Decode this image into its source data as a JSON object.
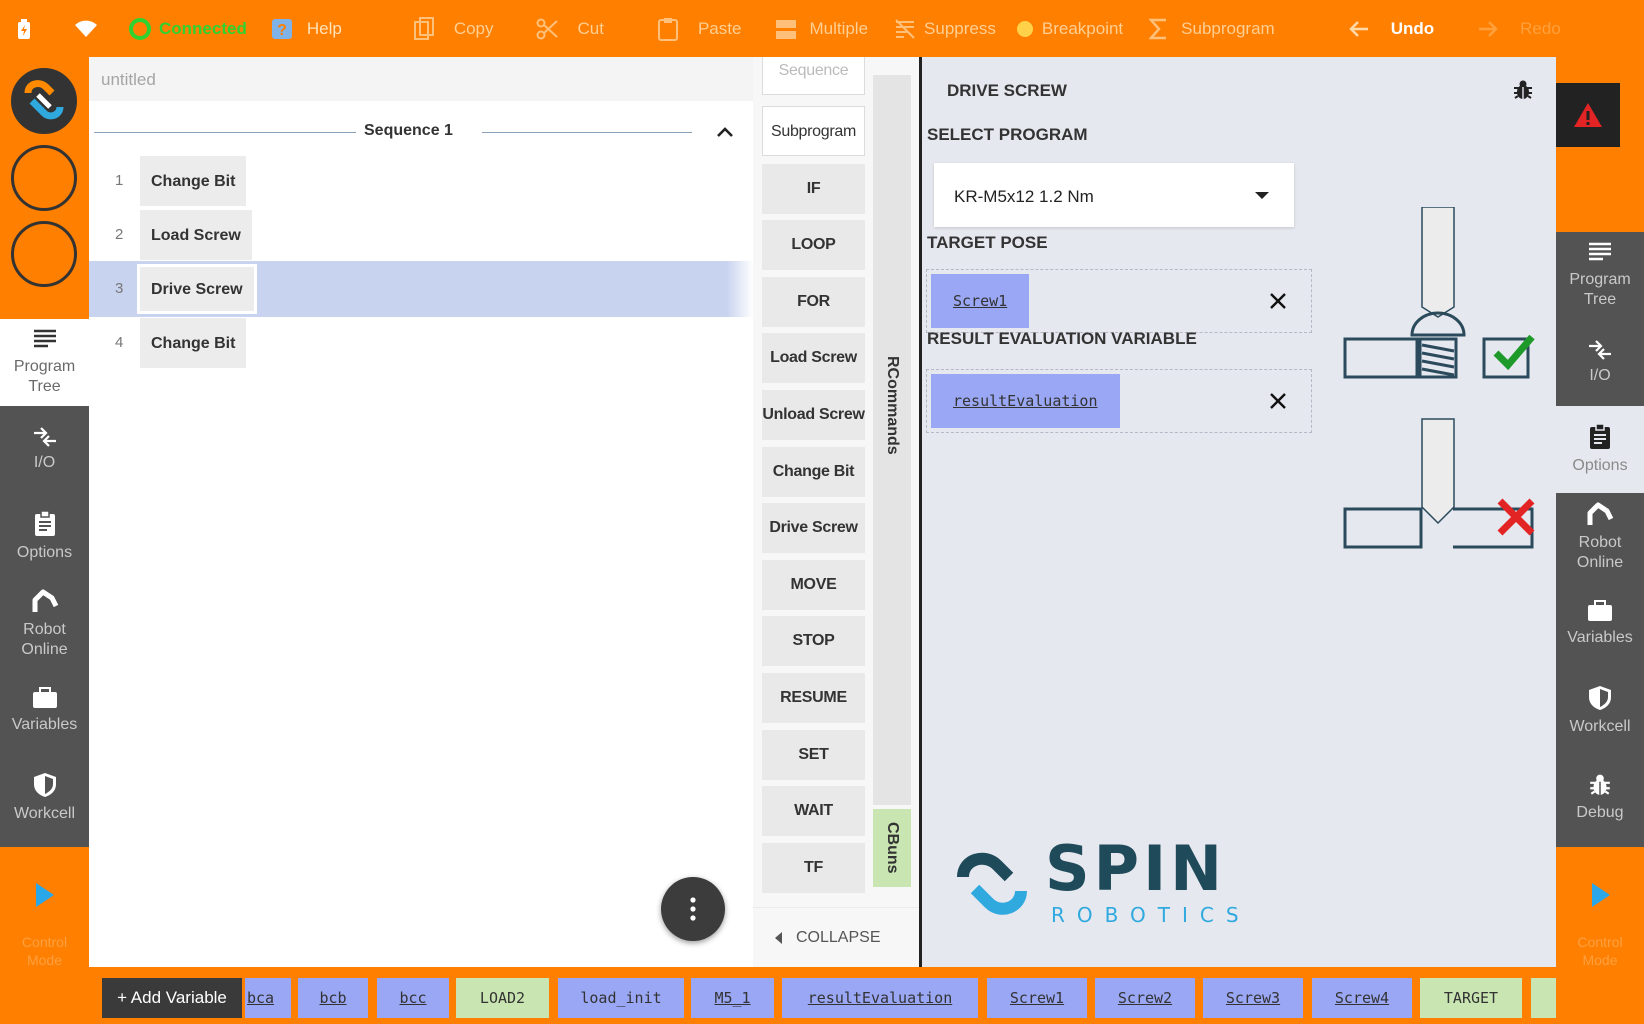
{
  "toolbar": {
    "items": [
      {
        "id": "connected",
        "label": "Connected",
        "icon": "connected-icon"
      },
      {
        "id": "help",
        "label": "Help",
        "icon": "help-icon"
      },
      {
        "id": "copy",
        "label": "Copy",
        "icon": "copy-icon"
      },
      {
        "id": "cut",
        "label": "Cut",
        "icon": "scissors-icon"
      },
      {
        "id": "paste",
        "label": "Paste",
        "icon": "clipboard-icon"
      },
      {
        "id": "multiple",
        "label": "Multiple",
        "icon": "multiple-icon"
      },
      {
        "id": "suppress",
        "label": "Suppress",
        "icon": "suppress-icon"
      },
      {
        "id": "breakpoint",
        "label": "Breakpoint",
        "icon": "breakpoint-icon"
      },
      {
        "id": "subprogram",
        "label": "Subprogram",
        "icon": "sigma-icon"
      },
      {
        "id": "undo",
        "label": "Undo",
        "icon": "arrow-left-icon"
      },
      {
        "id": "redo",
        "label": "Redo",
        "icon": "arrow-right-icon"
      }
    ]
  },
  "left_nav": [
    {
      "id": "program-tree",
      "label": "Program Tree",
      "lines": [
        "Program",
        "Tree"
      ],
      "active": true
    },
    {
      "id": "io",
      "label": "I/O",
      "lines": [
        "I/O"
      ],
      "active": false
    },
    {
      "id": "options",
      "label": "Options",
      "lines": [
        "Options"
      ],
      "active": false
    },
    {
      "id": "robot-online",
      "label": "Robot Online",
      "lines": [
        "Robot",
        "Online"
      ],
      "active": false
    },
    {
      "id": "variables",
      "label": "Variables",
      "lines": [
        "Variables"
      ],
      "active": false
    },
    {
      "id": "workcell",
      "label": "Workcell",
      "lines": [
        "Workcell"
      ],
      "active": false
    }
  ],
  "control_mode": {
    "lines": [
      "Control",
      "Mode"
    ]
  },
  "program": {
    "name": "untitled",
    "sequence_title": "Sequence 1",
    "nodes": [
      {
        "num": "1",
        "label": "Change Bit",
        "selected": false
      },
      {
        "num": "2",
        "label": "Load Screw",
        "selected": false
      },
      {
        "num": "3",
        "label": "Drive Screw",
        "selected": true
      },
      {
        "num": "4",
        "label": "Change Bit",
        "selected": false
      }
    ]
  },
  "commands": {
    "buttons": [
      "Sequence",
      "Subprogram",
      "IF",
      "LOOP",
      "FOR",
      "Load Screw",
      "Unload Screw",
      "Change Bit",
      "Drive Screw",
      "MOVE",
      "STOP",
      "RESUME",
      "SET",
      "WAIT",
      "TF"
    ],
    "tab_rcommands": "RCommands",
    "tab_cbuns": "CBuns",
    "collapse_label": "COLLAPSE"
  },
  "properties": {
    "title": "DRIVE SCREW",
    "select_program_label": "SELECT PROGRAM",
    "selected_program": "KR-M5x12 1.2 Nm",
    "target_pose_label": "TARGET POSE",
    "target_pose_value": "Screw1",
    "result_label": "RESULT EVALUATION VARIABLE",
    "result_value": "resultEvaluation",
    "brand_name": "SPIN",
    "brand_sub": "ROBOTICS",
    "colors": {
      "ok": "#1e9a2a",
      "fail": "#e32424",
      "brand_dark": "#1f4a5a",
      "brand_light": "#2fa9de"
    }
  },
  "right_nav": [
    {
      "id": "program-tree",
      "label": "Program Tree",
      "lines": [
        "Program",
        "Tree"
      ],
      "active": false
    },
    {
      "id": "io",
      "label": "I/O",
      "lines": [
        "I/O"
      ],
      "active": false
    },
    {
      "id": "options",
      "label": "Options",
      "lines": [
        "Options"
      ],
      "active": true
    },
    {
      "id": "robot-online",
      "label": "Robot Online",
      "lines": [
        "Robot",
        "Online"
      ],
      "active": false
    },
    {
      "id": "variables",
      "label": "Variables",
      "lines": [
        "Variables"
      ],
      "active": false
    },
    {
      "id": "workcell",
      "label": "Workcell",
      "lines": [
        "Workcell"
      ],
      "active": false
    },
    {
      "id": "debug",
      "label": "Debug",
      "lines": [
        "Debug"
      ],
      "active": false
    }
  ],
  "variables_bar": {
    "add_label": "+ Add Variable",
    "chips": [
      {
        "label": "bca",
        "type": "pose"
      },
      {
        "label": "bcb",
        "type": "pose"
      },
      {
        "label": "bcc",
        "type": "pose"
      },
      {
        "label": "LOAD2",
        "type": "other"
      },
      {
        "label": "load_init",
        "type": "pose"
      },
      {
        "label": "M5_1",
        "type": "pose"
      },
      {
        "label": "resultEvaluation",
        "type": "pose"
      },
      {
        "label": "Screw1",
        "type": "pose"
      },
      {
        "label": "Screw2",
        "type": "pose"
      },
      {
        "label": "Screw3",
        "type": "pose"
      },
      {
        "label": "Screw4",
        "type": "pose"
      },
      {
        "label": "TARGET",
        "type": "other"
      }
    ]
  }
}
